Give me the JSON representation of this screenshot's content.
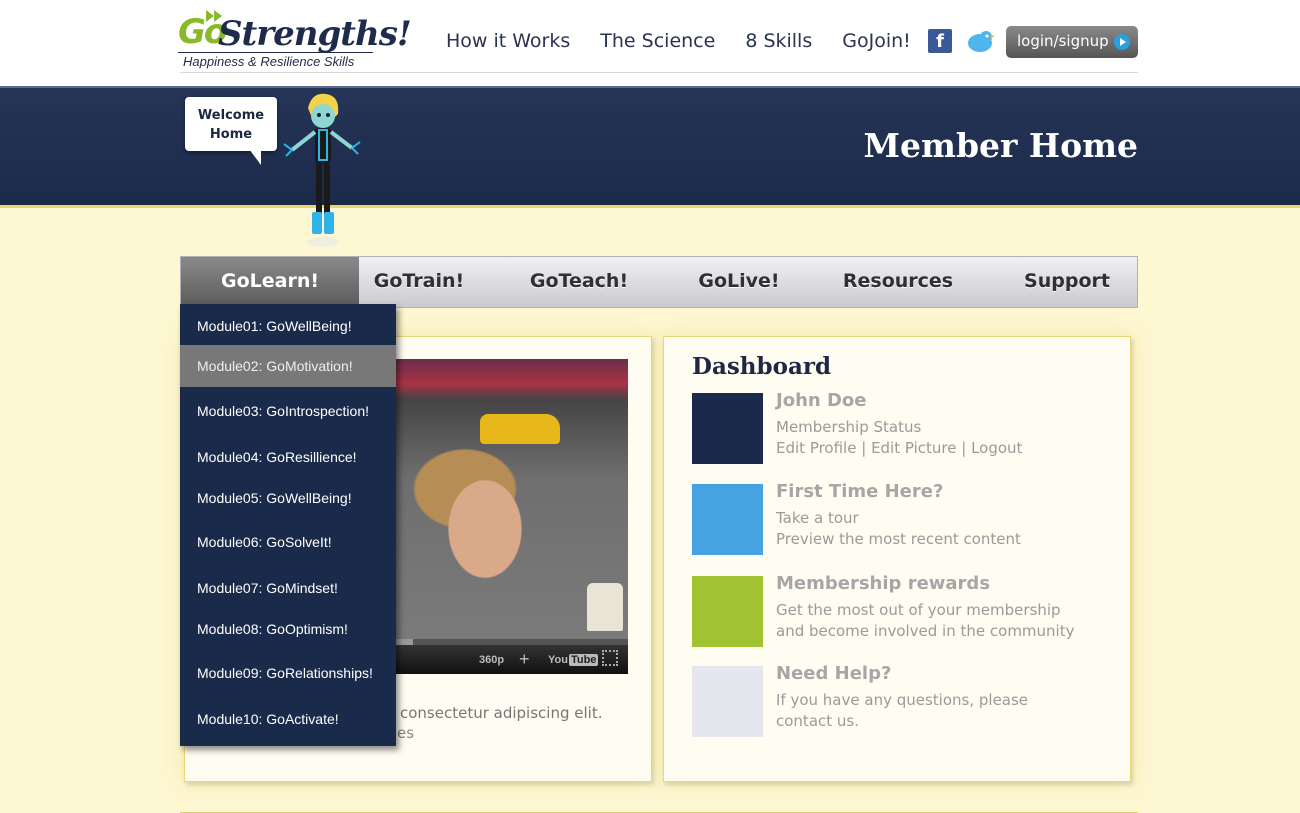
{
  "logo": {
    "go": "Go",
    "word": "Strengths!",
    "tagline": "Happiness & Resilience Skills"
  },
  "nav": [
    "How it Works",
    "The Science",
    "8 Skills",
    "GoJoin!"
  ],
  "social": {
    "facebook": "f",
    "twitter_icon": "twitter-bird-icon"
  },
  "login": "login/signup",
  "banner": {
    "title": "Member Home",
    "bubble_line1": "Welcome",
    "bubble_line2": "Home"
  },
  "tabs": [
    "GoLearn!",
    "GoTrain!",
    "GoTeach!",
    "GoLive!",
    "Resources",
    "Support"
  ],
  "active_tab": "GoLearn!",
  "dropdown": [
    "Module01: GoWellBeing!",
    "Module02: GoMotivation!",
    "Module03: GoIntrospection!",
    "Module04: GoResillience!",
    "Module05: GoWellBeing!",
    "Module06: GoSolveIt!",
    "Module07: GoMindset!",
    "Module08: GoOptimism!",
    "Module09: GoRelationships!",
    "Module10: GoActivate!"
  ],
  "video": {
    "quality": "360p",
    "plus": "+",
    "yt_you": "You",
    "yt_tube": "Tube"
  },
  "lorem": {
    "line1": "consectetur adipiscing elit.",
    "line2": "es"
  },
  "dashboard": {
    "title": "Dashboard",
    "items": [
      {
        "color": "#1b2a4c",
        "heading": "John Doe",
        "lines": [
          "Membership Status"
        ],
        "links": [
          "Edit Profile",
          "Edit Picture",
          "Logout"
        ],
        "sep": " | "
      },
      {
        "color": "#44a3e0",
        "heading": "First Time Here?",
        "lines": [
          "Take a tour",
          "Preview the most recent content"
        ]
      },
      {
        "color": "#9fc331",
        "heading": "Membership rewards",
        "lines": [
          "Get the most out of your membership",
          "and become involved in the community"
        ]
      },
      {
        "color": "#e6e6ee",
        "heading": "Need Help?",
        "lines": [
          "If you have any questions, please",
          "contact us."
        ]
      }
    ]
  },
  "colors": {
    "navy": "#1a2a4a",
    "accent_green": "#8ab82b",
    "banner": "#253557",
    "background": "#fdf7d2"
  }
}
